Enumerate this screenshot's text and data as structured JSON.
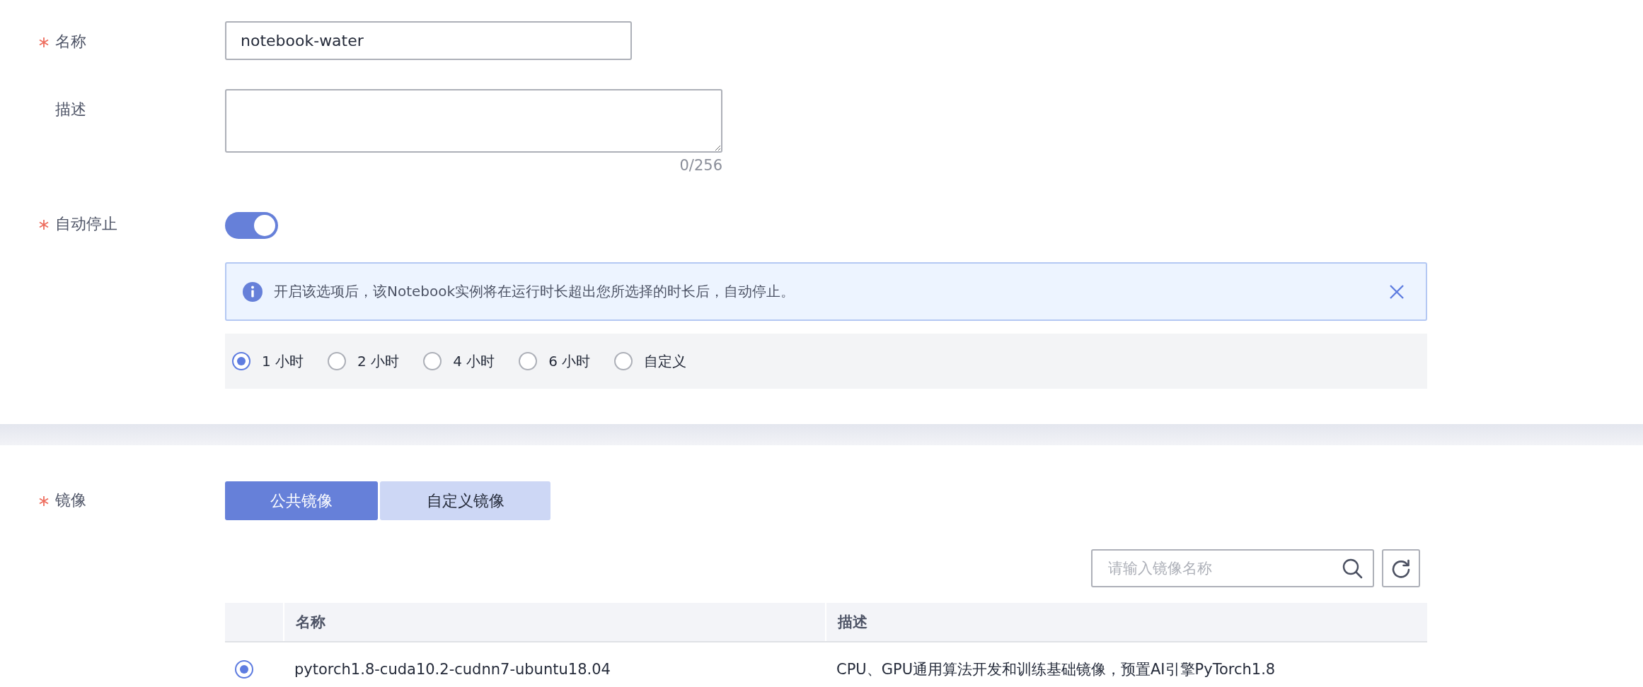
{
  "basic": {
    "name_field": {
      "label": "名称",
      "required": true,
      "value": "notebook-water"
    },
    "description_field": {
      "label": "描述",
      "required": false,
      "counter": "0/256"
    },
    "auto_stop": {
      "label": "自动停止",
      "required": true,
      "on": true,
      "notice": {
        "text": "开启该选项后，该Notebook实例将在运行时长超出您所选择的时长后，自动停止。"
      },
      "durations": [
        {
          "label": "1 小时",
          "selected": true
        },
        {
          "label": "2 小时",
          "selected": false
        },
        {
          "label": "4 小时",
          "selected": false
        },
        {
          "label": "6 小时",
          "selected": false
        },
        {
          "label": "自定义",
          "selected": false
        }
      ]
    }
  },
  "image": {
    "label": "镜像",
    "required": true,
    "tabs": [
      {
        "label": "公共镜像",
        "selected": true
      },
      {
        "label": "自定义镜像",
        "selected": false
      }
    ],
    "search": {
      "placeholder": "请输入镜像名称"
    },
    "table": {
      "columns": [
        "名称",
        "描述"
      ],
      "rows": [
        {
          "selected": true,
          "name": "pytorch1.8-cuda10.2-cudnn7-ubuntu18.04",
          "description": "CPU、GPU通用算法开发和训练基础镜像，预置AI引擎PyTorch1.8"
        }
      ]
    }
  }
}
